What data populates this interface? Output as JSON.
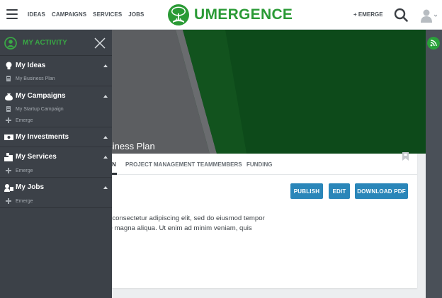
{
  "header": {
    "nav": [
      "IDEAS",
      "CAMPAIGNS",
      "SERVICES",
      "JOBS"
    ],
    "brand": "UMERGENCE",
    "emerge_label": "+ EMERGE"
  },
  "hero": {
    "title": "usiness Plan"
  },
  "tabs": [
    {
      "label": "N"
    },
    {
      "label": "PROJECT MANAGEMENT"
    },
    {
      "label": "TEAMMEMBERS"
    },
    {
      "label": "FUNDING"
    }
  ],
  "actions": {
    "publish": "PUBLISH",
    "edit": "EDIT",
    "download": "DOWNLOAD PDF"
  },
  "content": {
    "line1": "et, consectetur adipiscing elit, sed do eiusmod tempor",
    "line2": "ore magna aliqua. Ut enim ad minim veniam, quis"
  },
  "sidebar": {
    "title": "MY ACTIVITY",
    "sections": [
      {
        "title": "My Ideas",
        "icon": "lightbulb-icon",
        "items": [
          {
            "label": "My Business Plan",
            "icon": "document-icon"
          }
        ]
      },
      {
        "title": "My Campaigns",
        "icon": "money-bag-icon",
        "items": [
          {
            "label": "My Startup Campaign",
            "icon": "document-icon"
          },
          {
            "label": "Emerge",
            "icon": "plus-icon"
          }
        ]
      },
      {
        "title": "My Investments",
        "icon": "money-bill-icon",
        "items": []
      },
      {
        "title": "My Services",
        "icon": "services-icon",
        "items": [
          {
            "label": "Emerge",
            "icon": "plus-icon"
          }
        ]
      },
      {
        "title": "My Jobs",
        "icon": "user-card-icon",
        "items": [
          {
            "label": "Emerge",
            "icon": "plus-icon"
          }
        ]
      }
    ]
  },
  "colors": {
    "brand_green": "#2a9a35",
    "hero_green": "#0d4a1a",
    "button_blue": "#2a86b9",
    "sidebar_bg": "#3c4148"
  }
}
